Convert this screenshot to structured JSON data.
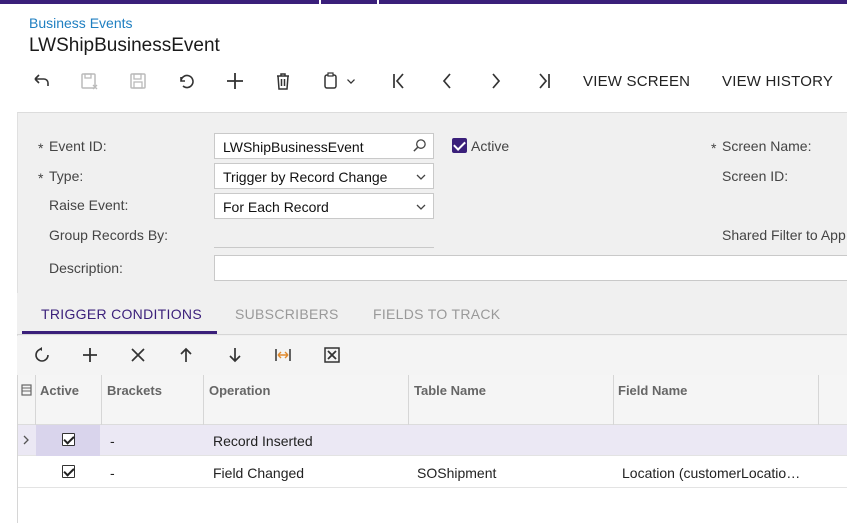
{
  "breadcrumb": "Business Events",
  "title": "LWShipBusinessEvent",
  "toolbar": {
    "view_screen": "VIEW SCREEN",
    "view_history": "VIEW HISTORY",
    "icons": [
      "undo-arrow-icon",
      "save-close-icon",
      "save-icon",
      "cancel-icon",
      "add-icon",
      "delete-icon",
      "copy-paste-icon",
      "chevron-down-icon",
      "first-icon",
      "previous-icon",
      "next-icon",
      "last-icon"
    ]
  },
  "form": {
    "event_id_label": "Event ID:",
    "event_id_value": "LWShipBusinessEvent",
    "active_label": "Active",
    "active_checked": true,
    "type_label": "Type:",
    "type_value": "Trigger by Record Change",
    "raise_event_label": "Raise Event:",
    "raise_event_value": "For Each Record",
    "group_records_label": "Group Records By:",
    "group_records_value": "",
    "description_label": "Description:",
    "description_value": "",
    "screen_name_label": "Screen Name:",
    "screen_id_label": "Screen ID:",
    "shared_filter_label": "Shared Filter to App",
    "required_marker": "*"
  },
  "tabs": [
    {
      "label": "TRIGGER CONDITIONS",
      "active": true
    },
    {
      "label": "SUBSCRIBERS",
      "active": false
    },
    {
      "label": "FIELDS TO TRACK",
      "active": false
    }
  ],
  "grid": {
    "columns": [
      "Active",
      "Brackets",
      "Operation",
      "Table Name",
      "Field Name"
    ],
    "rows": [
      {
        "active": true,
        "brackets": "-",
        "operation": "Record Inserted",
        "table_name": "",
        "field_name": ""
      },
      {
        "active": true,
        "brackets": "-",
        "operation": "Field Changed",
        "table_name": "SOShipment",
        "field_name": "Location (customerLocatio…"
      }
    ]
  },
  "colors": {
    "accent": "#3a1f7a",
    "link": "#1f7fc1"
  }
}
